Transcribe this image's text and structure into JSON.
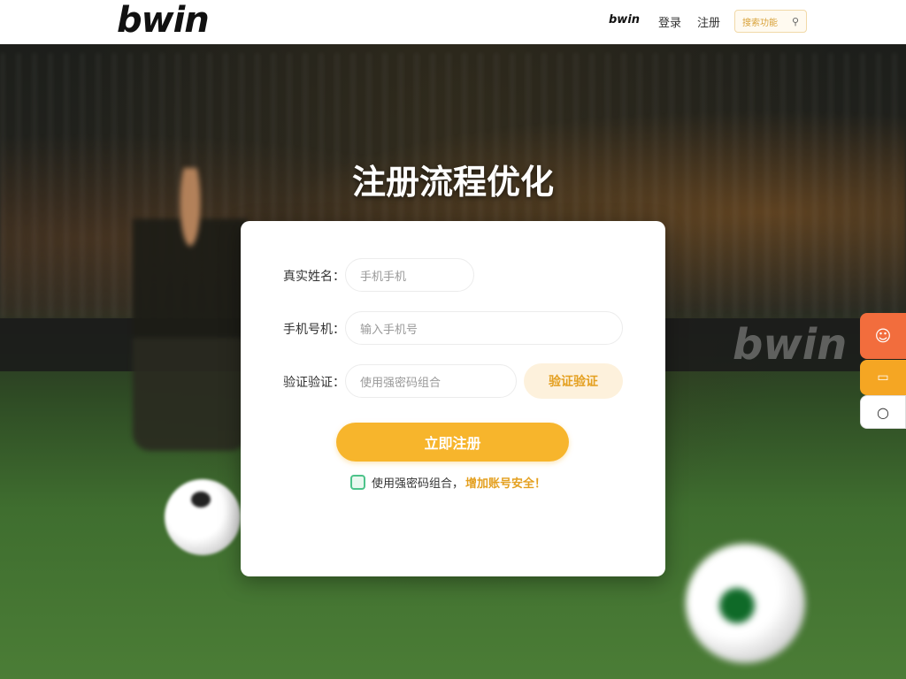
{
  "header": {
    "logo": "bwin",
    "nav_brand": "bwin",
    "nav_login": "登录",
    "nav_register": "注册",
    "search_placeholder": "搜索功能",
    "search_icon": "search-icon"
  },
  "page": {
    "title": "注册流程优化",
    "background_text": "bwin"
  },
  "form": {
    "name_label": "真实姓名：",
    "name_placeholder": "手机手机",
    "phone_label": "手机号机：",
    "phone_placeholder": "输入手机号",
    "code_label": "验证验证：",
    "code_placeholder": "使用强密码组合",
    "code_button": "验证验证",
    "submit": "立即注册",
    "tip_prefix": "使用强密码组合，",
    "tip_highlight": "增加账号安全！"
  },
  "floating": {
    "btn1_icon": "chat-icon",
    "btn2_icon": "message-icon",
    "btn3_icon": "circle-icon"
  },
  "colors": {
    "accent": "#f7b52c",
    "accent_text": "#e4a020",
    "float_orange": "#f26d3d"
  }
}
